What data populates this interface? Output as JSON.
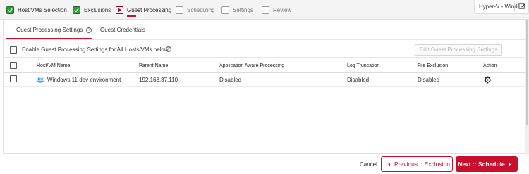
{
  "wizard": {
    "steps": [
      {
        "label": "Host/VMs Selection",
        "state": "done"
      },
      {
        "label": "Exclusions",
        "state": "done"
      },
      {
        "label": "Guest Processing",
        "state": "current"
      },
      {
        "label": "Scheduling",
        "state": "pending"
      },
      {
        "label": "Settings",
        "state": "pending"
      },
      {
        "label": "Review",
        "state": "pending"
      }
    ],
    "context_tab": "Hyper-V - Wind..."
  },
  "tabs": [
    {
      "label": "Guest Processing Settings",
      "help": "?",
      "active": true
    },
    {
      "label": "Guest Credentials",
      "active": false
    }
  ],
  "enable_row": {
    "label": "Enable Guest Processing Settings for All Hosts/VMs below",
    "help": "?",
    "checked": false,
    "edit_button": "Edit Guest Processing Settings",
    "edit_button_enabled": false
  },
  "table": {
    "headers": [
      "Host/VM Name",
      "Parent Name",
      "Application Aware Processing",
      "Log Truncation",
      "File Exclusion",
      "Action"
    ],
    "rows": [
      {
        "name": "Windows 11 dev environment",
        "parent": "192.168.37.110",
        "app_aware": "Disabled",
        "log_truncation": "Disabled",
        "file_exclusion": "Disabled",
        "action_icon": "gear-icon",
        "checked": false
      }
    ]
  },
  "footer": {
    "cancel": "Cancel",
    "previous": "Previous :: Exclusion",
    "next": "Next :: Schedule"
  },
  "colors": {
    "accent": "#c8102e",
    "done": "#2e9e3a"
  }
}
